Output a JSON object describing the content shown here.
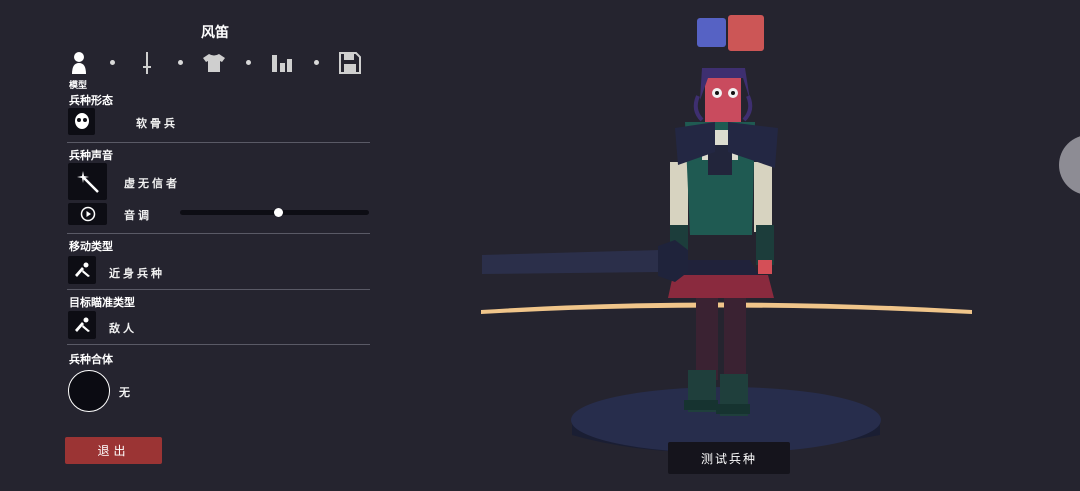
{
  "unit": {
    "name": "风笛"
  },
  "tabs": [
    {
      "icon": "person-icon",
      "label": "模型"
    },
    {
      "icon": "sword-icon"
    },
    {
      "icon": "shirt-icon"
    },
    {
      "icon": "stats-icon"
    },
    {
      "icon": "save-icon"
    }
  ],
  "sections": {
    "form": {
      "title": "兵种形态",
      "value": "软骨兵",
      "icon": "skull-icon"
    },
    "voice": {
      "title": "兵种声音",
      "value": "虚无信者",
      "icon": "magic-wand-icon",
      "pitch_label": "音调",
      "pitch_level": 0.52
    },
    "movement": {
      "title": "移动类型",
      "value": "近身兵种",
      "icon": "melee-icon"
    },
    "targeting": {
      "title": "目标瞄准类型",
      "value": "敌人",
      "icon": "target-icon"
    },
    "combine": {
      "title": "兵种合体",
      "value": "无"
    }
  },
  "buttons": {
    "exit": "退出",
    "test_unit": "测试兵种"
  },
  "team_colors": {
    "blue": "#5662c4",
    "red": "#cc5656"
  },
  "accent": {
    "exit": "#9b3434",
    "background": "#25242f",
    "range_ring": "#f0c58a"
  }
}
